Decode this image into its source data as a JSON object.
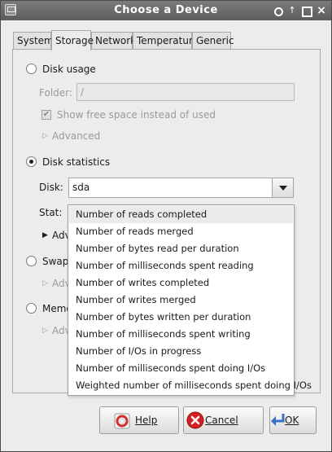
{
  "window": {
    "title": "Choose a Device"
  },
  "tabs": [
    {
      "label": "System"
    },
    {
      "label": "Storage"
    },
    {
      "label": "Network"
    },
    {
      "label": "Temperature"
    },
    {
      "label": "Generic"
    }
  ],
  "active_tab": "Storage",
  "disk_usage": {
    "label": "Disk usage",
    "folder_label": "Folder:",
    "folder_value": "/",
    "show_free_label": "Show free space instead of used",
    "advanced_label": "Advanced"
  },
  "disk_statistics": {
    "label": "Disk statistics",
    "disk_label": "Disk:",
    "disk_value": "sda",
    "stat_label": "Stat:",
    "advanced_label": "Adv"
  },
  "swap": {
    "label": "Swap",
    "advanced_label": "Adv"
  },
  "memory": {
    "label": "Memo",
    "advanced_label": "Adv"
  },
  "stat_options": [
    "Number of reads completed",
    "Number of reads merged",
    "Number of bytes read per duration",
    "Number of milliseconds spent reading",
    "Number of writes completed",
    "Number of writes merged",
    "Number of bytes written per duration",
    "Number of milliseconds spent writing",
    "Number of I/Os in progress",
    "Number of milliseconds spent doing I/Os",
    "Weighted number of milliseconds spent doing I/Os"
  ],
  "highlighted_option": "Number of reads completed",
  "buttons": {
    "help": "Help",
    "cancel": "Cancel",
    "ok": "OK"
  },
  "colors": {
    "titlebar": "#5c5c5c",
    "window_bg": "#ececec",
    "cancel_icon": "#d42020",
    "ok_icon": "#3a6fc4"
  }
}
